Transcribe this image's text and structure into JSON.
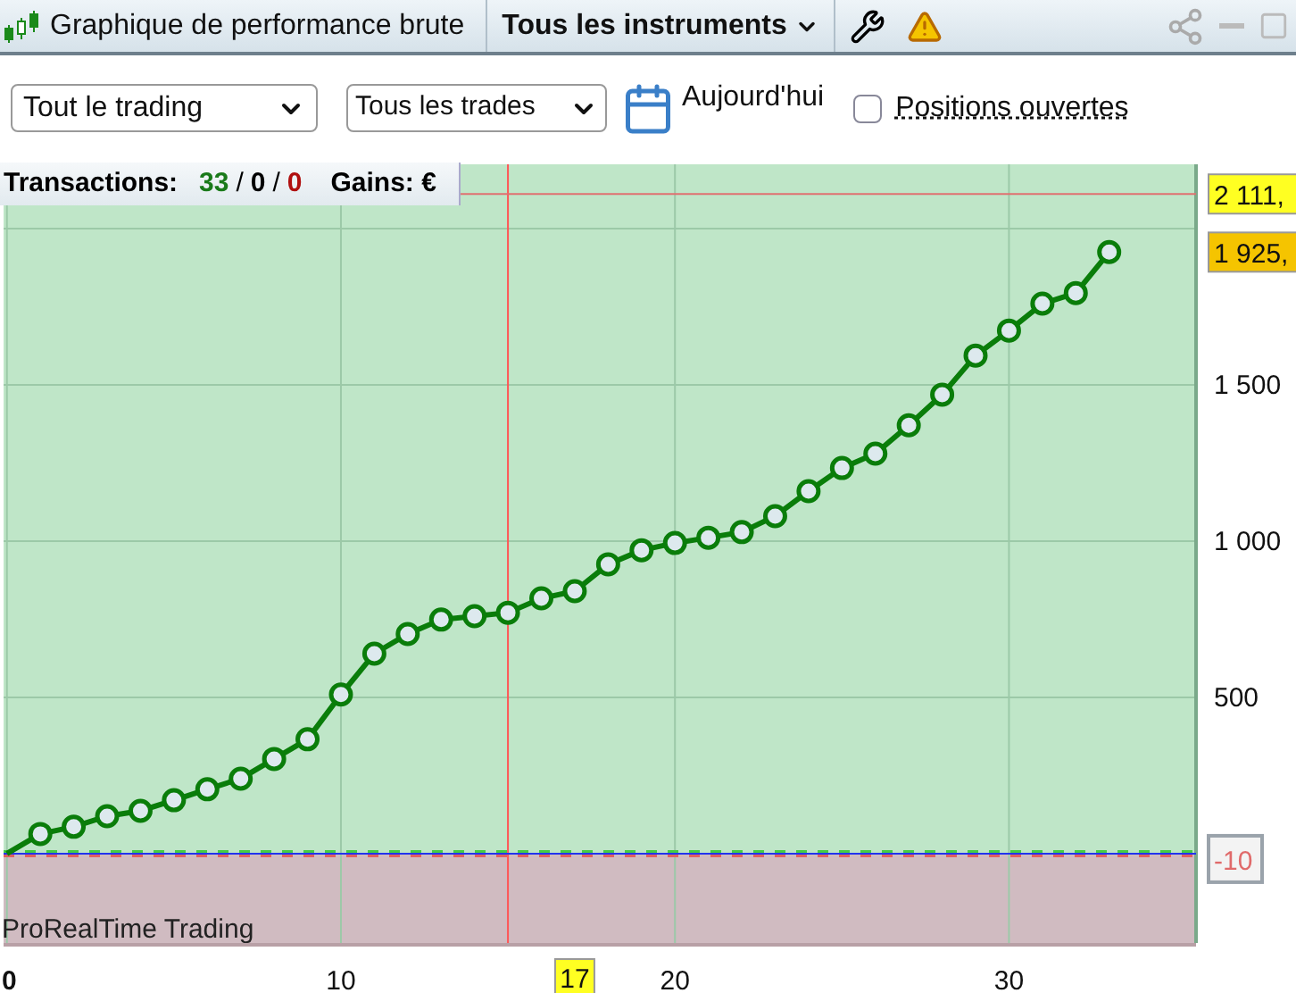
{
  "title_bar": {
    "title": "Graphique de performance brute",
    "instrument_menu": "Tous les instruments"
  },
  "filters": {
    "scope_select": "Tout le trading",
    "trades_select": "Tous les trades",
    "date_button": "Aujourd'hui",
    "open_positions": {
      "label": "Positions ouvertes",
      "checked": false
    }
  },
  "summary": {
    "label": "Transactions:",
    "total": "33",
    "separator_1": "/",
    "neutral": "0",
    "separator_2": "/",
    "losing": "0",
    "gains_label": "Gains: €"
  },
  "chart": {
    "watermark": "ProRealTime Trading",
    "chart_data": {
      "type": "line",
      "grid": true,
      "x": [
        0,
        1,
        2,
        3,
        4,
        5,
        6,
        7,
        8,
        9,
        10,
        11,
        12,
        13,
        14,
        15,
        16,
        17,
        18,
        19,
        20,
        21,
        22,
        23,
        24,
        25,
        26,
        27,
        28,
        29,
        30,
        31,
        32,
        33
      ],
      "series": [
        {
          "color": "#0a7d0a",
          "marker": "o",
          "values": [
            0,
            63,
            86,
            120,
            137,
            171,
            206,
            240,
            303,
            366,
            509,
            640,
            703,
            749,
            760,
            771,
            817,
            840,
            926,
            971,
            994,
            1011,
            1029,
            1080,
            1160,
            1234,
            1280,
            1371,
            1469,
            1594,
            1674,
            1760,
            1794,
            1925
          ]
        }
      ],
      "xlim": [
        -0.1,
        35.6
      ],
      "ylim": [
        -286,
        2206
      ],
      "xticks": [
        0,
        10,
        20,
        30
      ],
      "yticks": [
        {
          "value": 500,
          "label": "500"
        },
        {
          "value": 1000,
          "label": "1 000"
        },
        {
          "value": 1500,
          "label": "1 500"
        }
      ],
      "bands": [
        {
          "axis": "y",
          "from": 0,
          "to": 2206,
          "color": "#bfe6c8"
        },
        {
          "axis": "y",
          "from": -286,
          "to": 0,
          "color": "#d0bbc1"
        }
      ],
      "ref_lines": [
        {
          "axis": "x",
          "value": 15,
          "color": "#ff5555"
        },
        {
          "axis": "y",
          "value": 2111,
          "color": "#e07070"
        },
        {
          "axis": "y",
          "value": 0,
          "color": "#44cc44"
        },
        {
          "axis": "y",
          "value": 0,
          "color": "#e06060"
        },
        {
          "axis": "y",
          "value": 0,
          "color": "#2233ee"
        }
      ],
      "annotations": [
        "2 111,",
        "1 925,",
        "-10",
        "17"
      ]
    }
  }
}
